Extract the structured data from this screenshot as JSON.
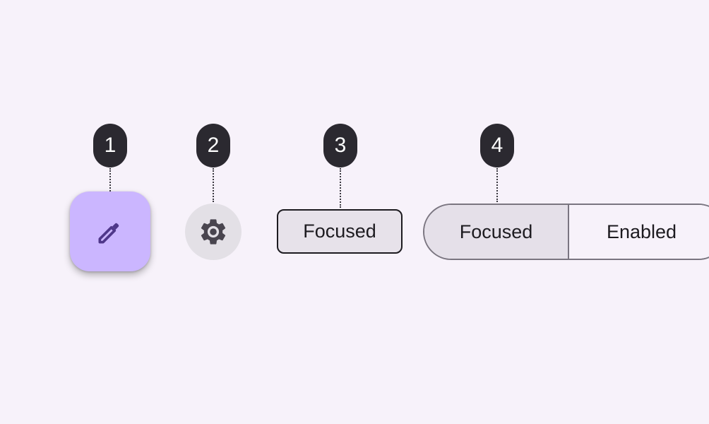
{
  "callouts": [
    {
      "number": "1"
    },
    {
      "number": "2"
    },
    {
      "number": "3"
    },
    {
      "number": "4"
    }
  ],
  "fab": {
    "icon": "pencil-icon",
    "color": "#cbb6ff",
    "icon_color": "#4f378a"
  },
  "icon_button": {
    "icon": "gear-icon",
    "color": "#e3e0e6",
    "icon_color": "#49454f"
  },
  "chip": {
    "label": "Focused"
  },
  "segmented_button": {
    "segments": [
      {
        "label": "Focused",
        "state": "focused"
      },
      {
        "label": "Enabled",
        "state": "enabled"
      }
    ]
  },
  "colors": {
    "background": "#f7f2fa",
    "badge": "#2b2930",
    "outline": "#7a7580"
  }
}
